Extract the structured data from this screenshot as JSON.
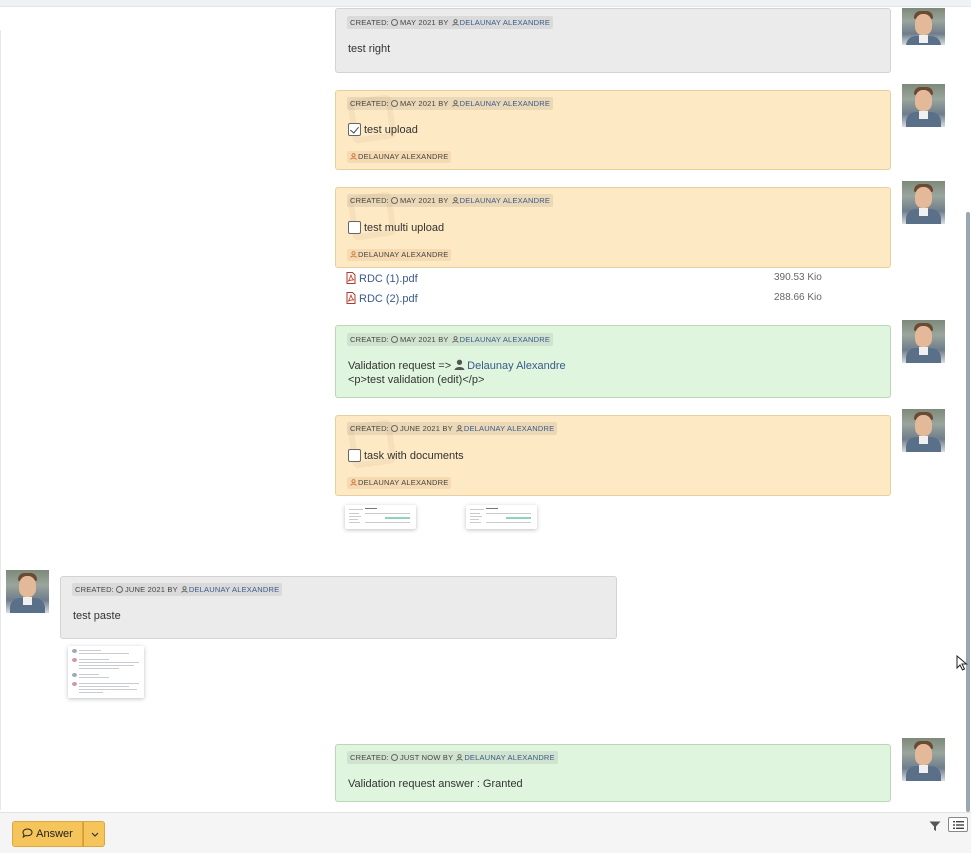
{
  "messages": [
    {
      "meta": {
        "created_label": "CREATED:",
        "date": "MAY 2021",
        "by": "BY",
        "user": "DELAUNAY ALEXANDRE"
      },
      "text": "test right"
    },
    {
      "meta": {
        "created_label": "CREATED:",
        "date": "MAY 2021",
        "by": "BY",
        "user": "DELAUNAY ALEXANDRE"
      },
      "text": "test upload",
      "assignee": "DELAUNAY ALEXANDRE"
    },
    {
      "meta": {
        "created_label": "CREATED:",
        "date": "MAY 2021",
        "by": "BY",
        "user": "DELAUNAY ALEXANDRE"
      },
      "text": "test multi upload",
      "assignee": "DELAUNAY ALEXANDRE",
      "files": [
        {
          "name": "RDC (1).pdf",
          "size": "390.53 Kio"
        },
        {
          "name": "RDC (2).pdf",
          "size": "288.66 Kio"
        }
      ]
    },
    {
      "meta": {
        "created_label": "CREATED:",
        "date": "MAY 2021",
        "by": "BY",
        "user": "DELAUNAY ALEXANDRE"
      },
      "line1_prefix": "Validation request =>",
      "line1_user": "Delaunay Alexandre",
      "line2": "<p>test validation (edit)</p>"
    },
    {
      "meta": {
        "created_label": "CREATED:",
        "date": "JUNE 2021",
        "by": "BY",
        "user": "DELAUNAY ALEXANDRE"
      },
      "text": "task with documents",
      "assignee": "DELAUNAY ALEXANDRE"
    },
    {
      "meta": {
        "created_label": "CREATED:",
        "date": "JUNE 2021",
        "by": "BY",
        "user": "DELAUNAY ALEXANDRE"
      },
      "text": "test paste"
    },
    {
      "meta": {
        "created_label": "CREATED:",
        "date": "JUST NOW",
        "by": "BY",
        "user": "DELAUNAY ALEXANDRE"
      },
      "text": "Validation request answer : Granted"
    }
  ],
  "footer": {
    "answer_label": "Answer"
  },
  "colors": {
    "yellow_card": "#fde9c4",
    "green_card": "#dff5de",
    "grey_card": "#ebebeb",
    "accent_button": "#f5c45b",
    "link": "#3a5a8a"
  },
  "icons": {
    "clock": "clock-icon",
    "user": "user-icon",
    "pdf": "pdf-icon",
    "answer": "speech-bubble-icon",
    "filter": "filter-icon",
    "list": "list-icon"
  }
}
